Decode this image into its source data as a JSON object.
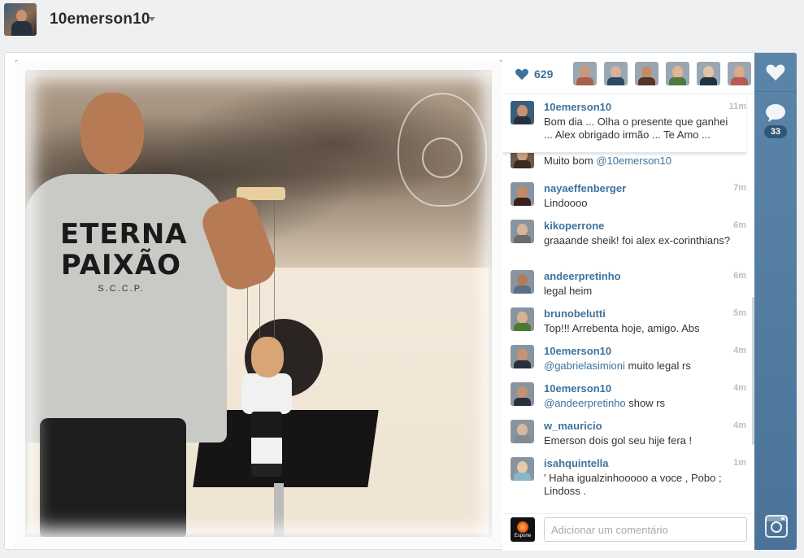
{
  "header": {
    "username": "10emerson10"
  },
  "post": {
    "like_count": "629",
    "comment_count": "33",
    "shirt_text_line1": "ETERNA",
    "shirt_text_line2": "PAIXÃO",
    "shirt_text_sub": "S.C.C.P."
  },
  "likers": [
    {
      "name": "liker-1",
      "skin": "#c9967a",
      "cloth": "#a85f4b"
    },
    {
      "name": "liker-2",
      "skin": "#d8b39a",
      "cloth": "#2c4a66"
    },
    {
      "name": "liker-3",
      "skin": "#c28c6a",
      "cloth": "#5a3326"
    },
    {
      "name": "liker-4",
      "skin": "#e2b596",
      "cloth": "#4f7a3d"
    },
    {
      "name": "liker-5",
      "skin": "#e6c2a3",
      "cloth": "#1f3242"
    },
    {
      "name": "liker-6",
      "skin": "#dca98c",
      "cloth": "#b95858"
    }
  ],
  "caption": {
    "user": "10emerson10",
    "time": "11m",
    "text": "Bom dia ... Olha o presente que ganhei ... Alex obrigado irmão ... Te Amo ..."
  },
  "partial_comment": {
    "text_plain": "Muito bom ",
    "mention": "@10emerson10"
  },
  "comments": [
    {
      "user": "nayaeffenberger",
      "time": "7m",
      "pre": "",
      "mention": "",
      "text": "Lindoooo",
      "skin": "#c48a66",
      "cloth": "#3a2018"
    },
    {
      "user": "kikoperrone",
      "time": "6m",
      "pre": "",
      "mention": "",
      "text": "graaande sheik! foi alex ex-corinthians?",
      "skin": "#d7b397",
      "cloth": "#6b6b6b"
    },
    {
      "user": "andeerpretinho",
      "time": "6m",
      "pre": "",
      "mention": "",
      "text": "legal heim",
      "skin": "#b27a56",
      "cloth": "#5a6e86"
    },
    {
      "user": "brunobelutti",
      "time": "5m",
      "pre": "",
      "mention": "",
      "text": "Top!!! Arrebenta hoje, amigo. Abs",
      "skin": "#d9b28f",
      "cloth": "#4a7a2f"
    },
    {
      "user": "10emerson10",
      "time": "4m",
      "pre": "",
      "mention": "@gabrielasimioni",
      "text": " muito legal rs",
      "skin": "#c89170",
      "cloth": "#26313d"
    },
    {
      "user": "10emerson10",
      "time": "4m",
      "pre": "",
      "mention": "@andeerpretinho",
      "text": " show rs",
      "skin": "#c89170",
      "cloth": "#26313d"
    },
    {
      "user": "w_mauricio",
      "time": "4m",
      "pre": "",
      "mention": "",
      "text": "Emerson dois gol seu hije fera !",
      "skin": "#d9b89e",
      "cloth": "#7f8c96"
    },
    {
      "user": "isahquintella",
      "time": "1m",
      "pre": "",
      "mention": "",
      "text": "' Haha igualzinhooooo a voce , Pobo ; Lindoss .",
      "skin": "#e7c9ad",
      "cloth": "#8ab4c8"
    }
  ],
  "comment_input": {
    "placeholder": "Adicionar um comentário",
    "avatar_label": "Esporte"
  },
  "colors": {
    "accent": "#3f729b",
    "rail": "#4b7399",
    "badge": "#2f5577"
  },
  "icons": {
    "like": "heart-icon",
    "comment": "speech-bubble-icon",
    "instagram": "instagram-camera-icon",
    "dropdown": "chevron-down-icon"
  }
}
